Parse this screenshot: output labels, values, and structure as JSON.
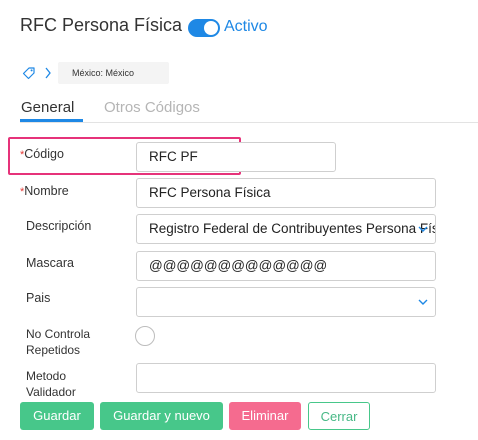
{
  "header": {
    "title": "RFC Persona Física",
    "toggle_label": "Activo",
    "toggle_on": true,
    "accent_color": "#1e88e5"
  },
  "breadcrumb": {
    "icon": "tag-icon",
    "separator_icon": "chevron-right-icon",
    "item": "México: México"
  },
  "tabs": [
    {
      "label": "General",
      "active": true
    },
    {
      "label": "Otros Códigos",
      "active": false
    }
  ],
  "form": {
    "required_marker": "*",
    "codigo": {
      "label": "Código",
      "value": "RFC PF",
      "required": true
    },
    "nombre": {
      "label": "Nombre",
      "value": "RFC Persona Física",
      "required": true
    },
    "descripcion": {
      "label": "Descripción",
      "value": "Registro Federal de Contribuyentes Persona Física",
      "icon": "chevron-down-icon"
    },
    "mascara": {
      "label": "Mascara",
      "value": "@@@@@@@@@@@@@"
    },
    "pais": {
      "label": "Pais",
      "value": "",
      "icon": "chevron-down-icon"
    },
    "no_controla": {
      "label_line1": "No Controla",
      "label_line2": "Repetidos",
      "checked": false
    },
    "metodo": {
      "label_line1": "Metodo",
      "label_line2": "Validador",
      "value": ""
    }
  },
  "buttons": {
    "guardar": "Guardar",
    "guardar_nuevo": "Guardar y nuevo",
    "eliminar": "Eliminar",
    "cerrar": "Cerrar"
  },
  "colors": {
    "highlight": "#e6337a",
    "primary_green": "#47c78a",
    "danger_pink": "#f56b8f",
    "required_red": "#e53935"
  }
}
